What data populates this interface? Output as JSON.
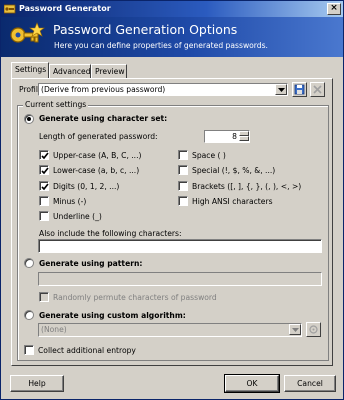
{
  "window": {
    "title": "Password Generator"
  },
  "banner": {
    "title": "Password Generation Options",
    "subtitle": "Here you can define properties of generated passwords."
  },
  "tabs": [
    {
      "label": "Settings",
      "active": true
    },
    {
      "label": "Advanced",
      "active": false
    },
    {
      "label": "Preview",
      "active": false
    }
  ],
  "profile": {
    "label": "Profile:",
    "value": "(Derive from previous password)",
    "save_icon": "save-profile-icon",
    "delete_icon": "delete-profile-icon"
  },
  "current_settings": {
    "legend": "Current settings",
    "charset_mode": {
      "label": "Generate using character set:",
      "selected": true,
      "length_label": "Length of generated password:",
      "length_value": "8",
      "options_left": [
        {
          "label": "Upper-case (A, B, C, ...)",
          "checked": true
        },
        {
          "label": "Lower-case (a, b, c, ...)",
          "checked": true
        },
        {
          "label": "Digits (0, 1, 2, ...)",
          "checked": true
        },
        {
          "label": "Minus (-)",
          "checked": false
        },
        {
          "label": "Underline (_)",
          "checked": false
        }
      ],
      "options_right": [
        {
          "label": "Space ( )",
          "checked": false
        },
        {
          "label": "Special (!, $, %, &, ...)",
          "checked": false
        },
        {
          "label": "Brackets ([, ], {, }, (, ), <, >)",
          "checked": false
        },
        {
          "label": "High ANSI characters",
          "checked": false
        }
      ],
      "also_include_label": "Also include the following characters:",
      "also_include_value": ""
    },
    "pattern_mode": {
      "label": "Generate using pattern:",
      "selected": false,
      "pattern_value": "",
      "permute_label": "Randomly permute characters of password",
      "permute_checked": false
    },
    "custom_mode": {
      "label": "Generate using custom algorithm:",
      "selected": false,
      "algorithm_value": "(None)"
    },
    "entropy": {
      "label": "Collect additional entropy",
      "checked": false
    }
  },
  "buttons": {
    "help": "Help",
    "ok": "OK",
    "cancel": "Cancel"
  }
}
